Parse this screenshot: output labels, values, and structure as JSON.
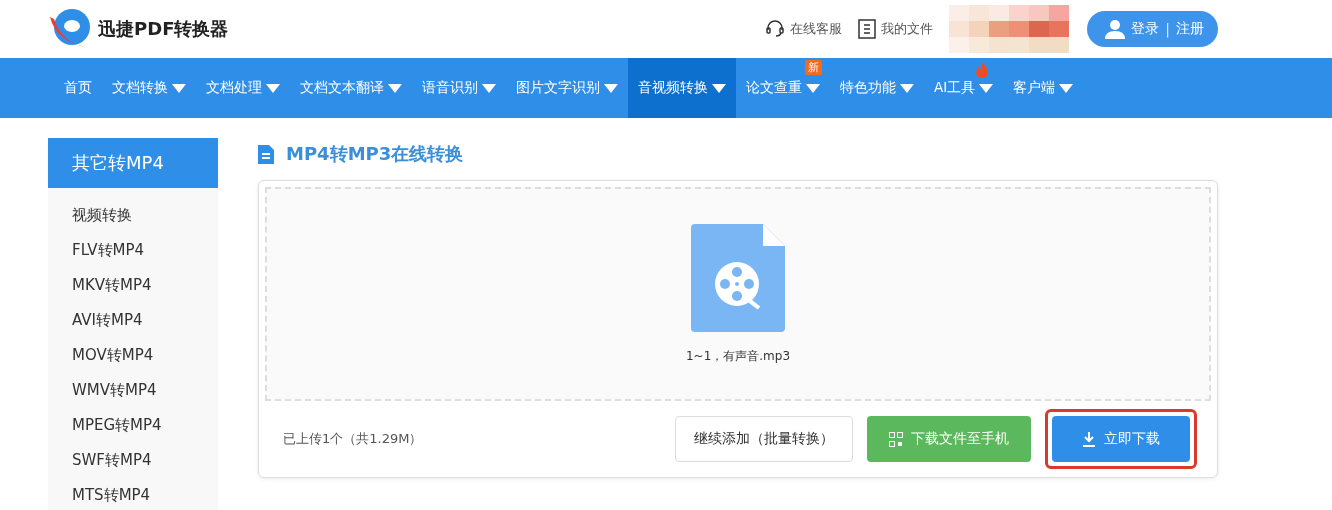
{
  "header": {
    "brand": "迅捷PDF转换器",
    "links": [
      {
        "kind": "support",
        "label": "在线客服"
      },
      {
        "kind": "files",
        "label": "我的文件"
      }
    ],
    "login": {
      "login": "登录",
      "separator": "|",
      "register": "注册"
    }
  },
  "nav": [
    {
      "label": "首页",
      "dropdown": false,
      "selected": false
    },
    {
      "label": "文档转换",
      "dropdown": true,
      "selected": false
    },
    {
      "label": "文档处理",
      "dropdown": true,
      "selected": false
    },
    {
      "label": "文档文本翻译",
      "dropdown": true,
      "selected": false
    },
    {
      "label": "语音识别",
      "dropdown": true,
      "selected": false
    },
    {
      "label": "图片文字识别",
      "dropdown": true,
      "selected": false
    },
    {
      "label": "音视频转换",
      "dropdown": true,
      "selected": true
    },
    {
      "label": "论文查重",
      "dropdown": true,
      "selected": false,
      "badge": "新"
    },
    {
      "label": "特色功能",
      "dropdown": true,
      "selected": false
    },
    {
      "label": "AI工具",
      "dropdown": true,
      "selected": false,
      "hot": true
    },
    {
      "label": "客户端",
      "dropdown": true,
      "selected": false
    }
  ],
  "sidebar": {
    "title": "其它转MP4",
    "items": [
      "视频转换",
      "FLV转MP4",
      "MKV转MP4",
      "AVI转MP4",
      "MOV转MP4",
      "WMV转MP4",
      "MPEG转MP4",
      "SWF转MP4",
      "MTS转MP4"
    ]
  },
  "main": {
    "title": "MP4转MP3在线转换",
    "file": {
      "name": "1~1，有声音.mp3"
    },
    "status": "已上传1个（共1.29M）",
    "buttons": [
      {
        "kind": "add",
        "label": "继续添加（批量转换）"
      },
      {
        "kind": "phone",
        "label": "下载文件至手机"
      },
      {
        "kind": "download",
        "label": "立即下载",
        "highlighted": true
      }
    ]
  }
}
